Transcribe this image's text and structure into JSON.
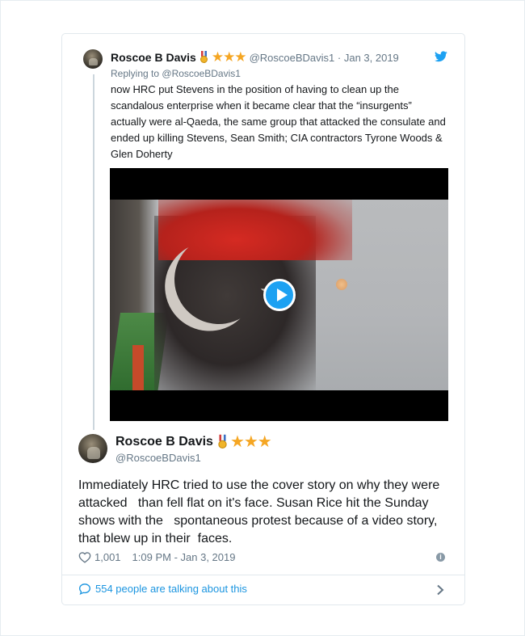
{
  "reply_tweet": {
    "name": "Roscoe B Davis",
    "stars": "★★★",
    "handle": "@RoscoeBDavis1",
    "date_sep": "·",
    "date": "Jan 3, 2019",
    "replying_label": "Replying to",
    "replying_to": "@RoscoeBDavis1",
    "text": "now HRC put Stevens in the position of having to clean up the scandalous enterprise when it became clear that the “insurgents” actually were al-Qaeda, the same group that attacked the consulate and ended up killing Stevens, Sean Smith; CIA contractors Tyrone Woods & Glen Doherty",
    "has_video": true
  },
  "main_tweet": {
    "name": "Roscoe B Davis",
    "stars": "★★★",
    "handle": "@RoscoeBDavis1",
    "text": "Immediately HRC tried to use the cover story on why they were attacked   than fell flat on it's face. Susan Rice hit the Sunday shows with the   spontaneous protest because of a video story, that blew up in their  faces.",
    "likes": "1,001",
    "timestamp": "1:09 PM - Jan 3, 2019"
  },
  "footer": {
    "talking": "554 people are talking about this"
  },
  "icons": {
    "brand": "twitter-bird-icon",
    "like": "heart-icon",
    "info": "info-icon",
    "comments": "speech-bubble-icon",
    "more": "chevron-right-icon"
  },
  "colors": {
    "twitter_blue": "#1da1f2",
    "link_blue": "#1b95e0",
    "muted": "#657786",
    "star": "#f5a623"
  }
}
